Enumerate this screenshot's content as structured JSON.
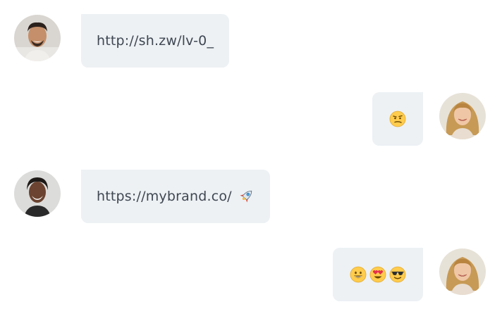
{
  "messages": [
    {
      "direction": "incoming",
      "avatar": "man-portrait-avatar",
      "text": "http://sh.zw/lv-0_",
      "emojis": []
    },
    {
      "direction": "outgoing",
      "avatar": "woman-portrait-avatar",
      "text": "",
      "emojis": [
        "smirking-face-emoji"
      ]
    },
    {
      "direction": "incoming",
      "avatar": "woman-portrait-avatar-2",
      "text": "https://mybrand.co/",
      "emojis": [
        "rocket-emoji"
      ]
    },
    {
      "direction": "outgoing",
      "avatar": "woman-portrait-avatar",
      "text": "",
      "emojis": [
        "grinning-face-emoji",
        "heart-eyes-emoji",
        "sunglasses-face-emoji"
      ]
    }
  ],
  "colors": {
    "bubble_bg": "#edf1f4",
    "text": "#3f4752",
    "emoji_yellow": "#ffcc4d"
  }
}
